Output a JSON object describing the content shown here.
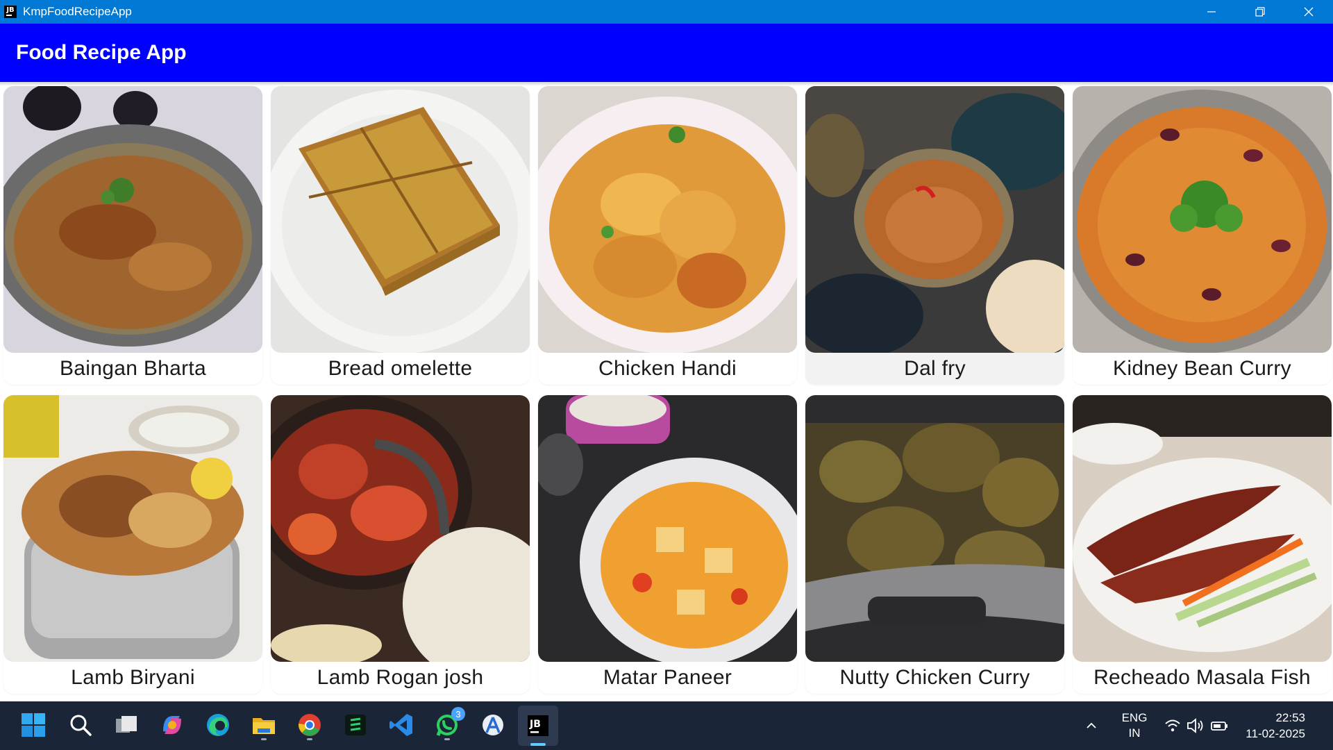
{
  "window": {
    "icon_label": "JB",
    "title": "KmpFoodRecipeApp"
  },
  "appbar": {
    "title": "Food Recipe App",
    "color": "#0000ff"
  },
  "recipes": [
    {
      "name": "Baingan Bharta"
    },
    {
      "name": "Bread omelette"
    },
    {
      "name": "Chicken Handi"
    },
    {
      "name": "Dal fry",
      "selected": true
    },
    {
      "name": "Kidney Bean Curry"
    },
    {
      "name": "Lamb Biryani"
    },
    {
      "name": "Lamb Rogan josh"
    },
    {
      "name": "Matar Paneer"
    },
    {
      "name": "Nutty Chicken Curry"
    },
    {
      "name": "Recheado Masala Fish"
    }
  ],
  "taskbar": {
    "apps": [
      "windows-start",
      "search",
      "task-view",
      "copilot",
      "edge",
      "file-explorer",
      "chrome",
      "app-green",
      "vs-code",
      "whatsapp",
      "android-studio",
      "intellij"
    ],
    "whatsapp_badge": "3",
    "language_line1": "ENG",
    "language_line2": "IN",
    "time": "22:53",
    "date": "11-02-2025"
  }
}
